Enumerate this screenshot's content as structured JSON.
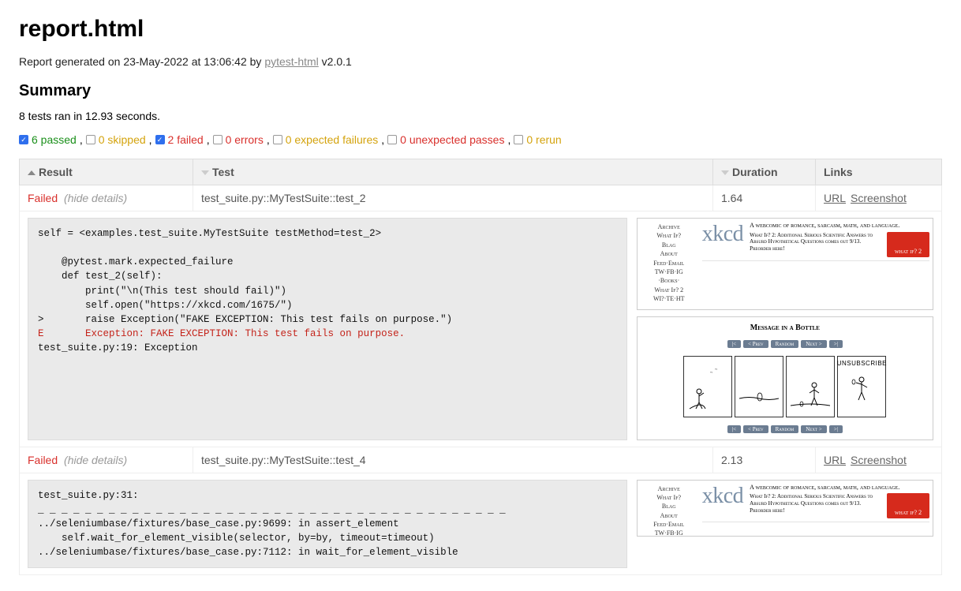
{
  "page_title": "report.html",
  "meta_prefix": "Report generated on 23-May-2022 at 13:06:42 by ",
  "meta_link": "pytest-html",
  "meta_suffix": " v2.0.1",
  "summary_heading": "Summary",
  "ran_line": "8 tests ran in 12.93 seconds.",
  "filters": {
    "passed": {
      "label": "6 passed",
      "checked": true
    },
    "skipped": {
      "label": "0 skipped",
      "checked": false
    },
    "failed": {
      "label": "2 failed",
      "checked": true
    },
    "errors": {
      "label": "0 errors",
      "checked": false
    },
    "expected": {
      "label": "0 expected failures",
      "checked": false
    },
    "unexpected": {
      "label": "0 unexpected passes",
      "checked": false
    },
    "rerun": {
      "label": "0 rerun",
      "checked": false
    }
  },
  "headers": {
    "result": "Result",
    "test": "Test",
    "duration": "Duration",
    "links": "Links"
  },
  "rows": [
    {
      "status": "Failed",
      "hide": "(hide details)",
      "test": "test_suite.py::MyTestSuite::test_2",
      "duration": "1.64",
      "links": {
        "url": "URL",
        "screenshot": "Screenshot"
      },
      "traceback_lines": [
        "self = <examples.test_suite.MyTestSuite testMethod=test_2>",
        "",
        "    @pytest.mark.expected_failure",
        "    def test_2(self):",
        "        print(\"\\n(This test should fail)\")",
        "        self.open(\"https://xkcd.com/1675/\")",
        ">       raise Exception(\"FAKE EXCEPTION: This test fails on purpose.\")"
      ],
      "traceback_error": "E       Exception: FAKE EXCEPTION: This test fails on purpose.",
      "traceback_footer": "\ntest_suite.py:19: Exception",
      "comic_title": "Message in a Bottle",
      "panel_text": "UNSUBSCRIBE"
    },
    {
      "status": "Failed",
      "hide": "(hide details)",
      "test": "test_suite.py::MyTestSuite::test_4",
      "duration": "2.13",
      "links": {
        "url": "URL",
        "screenshot": "Screenshot"
      },
      "traceback_lines": [
        "test_suite.py:31:",
        "_ _ _ _ _ _ _ _ _ _ _ _ _ _ _ _ _ _ _ _ _ _ _ _ _ _ _ _ _ _ _ _ _ _ _ _ _ _ _ _",
        "../seleniumbase/fixtures/base_case.py:9699: in assert_element",
        "    self.wait_for_element_visible(selector, by=by, timeout=timeout)",
        "../seleniumbase/fixtures/base_case.py:7112: in wait_for_element_visible"
      ]
    }
  ],
  "xkcd": {
    "nav": [
      "Archive",
      "What If?",
      "Blag",
      "About",
      "Feed·Email",
      "TW·FB·IG",
      "·Books·",
      "What If? 2",
      "WI?·TE·HT"
    ],
    "logo": "xkcd",
    "tagline": "A webcomic of romance, sarcasm, math, and language.",
    "subline": "What If? 2: Additional Serious Scientific Answers to Absurd Hypothetical Questions comes out 9/13. Preorder here!",
    "badge": "what if? 2",
    "nav_btns": [
      "|<",
      "< Prev",
      "Random",
      "Next >",
      ">|"
    ]
  }
}
